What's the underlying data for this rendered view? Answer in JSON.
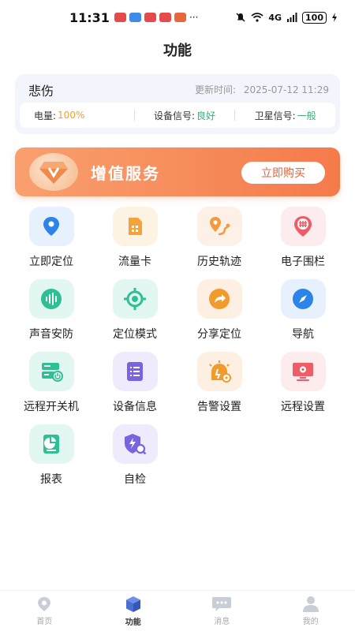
{
  "status_bar": {
    "time": "11:31",
    "dots": "···",
    "network": "4G",
    "battery": "100"
  },
  "page": {
    "title": "功能"
  },
  "device": {
    "name": "悲伤",
    "update_label": "更新时间:",
    "update_time": "2025-07-12 11:29",
    "stats": {
      "battery_label": "电量:",
      "battery_value": "100%",
      "device_signal_label": "设备信号:",
      "device_signal_value": "良好",
      "satellite_signal_label": "卫星信号:",
      "satellite_signal_value": "一般"
    }
  },
  "banner": {
    "title": "增值服务",
    "button": "立即购买"
  },
  "features": [
    {
      "label": "立即定位",
      "icon": "map-pin-icon",
      "bg": "#e7f1fd",
      "fg": "#2b84ea"
    },
    {
      "label": "流量卡",
      "icon": "sim-card-icon",
      "bg": "#fdf3e3",
      "fg": "#f3a33a"
    },
    {
      "label": "历史轨迹",
      "icon": "route-icon",
      "bg": "#fdf0e6",
      "fg": "#f39a3c"
    },
    {
      "label": "电子围栏",
      "icon": "fence-icon",
      "bg": "#fdeced",
      "fg": "#ee5c67"
    },
    {
      "label": "声音安防",
      "icon": "sound-wave-icon",
      "bg": "#e2f7f1",
      "fg": "#2fbf95"
    },
    {
      "label": "定位模式",
      "icon": "target-icon",
      "bg": "#e2f7f1",
      "fg": "#2fbf95"
    },
    {
      "label": "分享定位",
      "icon": "share-icon",
      "bg": "#fdf0e3",
      "fg": "#f39a2c"
    },
    {
      "label": "导航",
      "icon": "compass-icon",
      "bg": "#e7f1fd",
      "fg": "#2b84ea"
    },
    {
      "label": "远程开关机",
      "icon": "power-server-icon",
      "bg": "#e2f7f1",
      "fg": "#2fbf95"
    },
    {
      "label": "设备信息",
      "icon": "list-icon",
      "bg": "#efeafc",
      "fg": "#7a62e0"
    },
    {
      "label": "告警设置",
      "icon": "alarm-icon",
      "bg": "#fdf0e3",
      "fg": "#f39a2c"
    },
    {
      "label": "远程设置",
      "icon": "monitor-settings-icon",
      "bg": "#fdeced",
      "fg": "#ee5c67"
    },
    {
      "label": "报表",
      "icon": "report-icon",
      "bg": "#e2f7f1",
      "fg": "#2fbf95"
    },
    {
      "label": "自检",
      "icon": "self-check-icon",
      "bg": "#efeafc",
      "fg": "#7a62e0"
    }
  ],
  "nav": [
    {
      "label": "首页",
      "icon": "home-pin-icon"
    },
    {
      "label": "功能",
      "icon": "cube-icon"
    },
    {
      "label": "消息",
      "icon": "message-icon"
    },
    {
      "label": "我的",
      "icon": "user-icon"
    }
  ],
  "colors": {
    "accent_orange": "#f57a4a",
    "nav_active": "#4a6fd1",
    "nav_inactive": "#c8cdd6"
  }
}
